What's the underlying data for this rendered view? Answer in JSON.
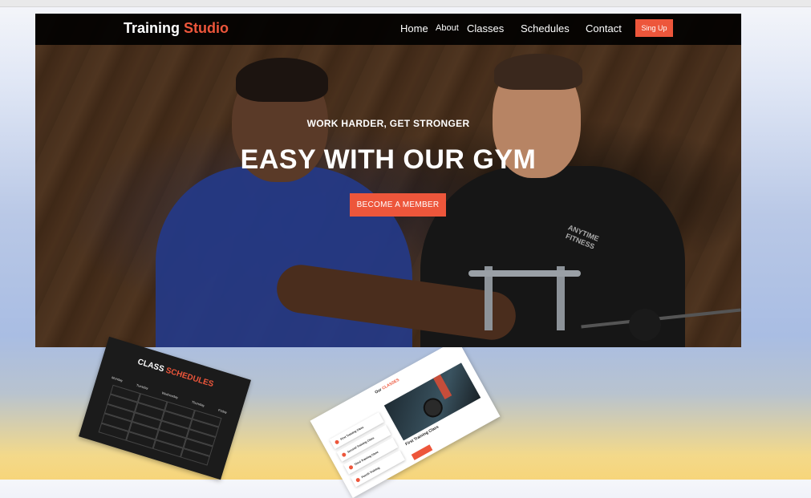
{
  "nav": {
    "logo_main": "Training",
    "logo_accent": "Studio",
    "items": [
      {
        "label": "Home"
      },
      {
        "label": "About"
      },
      {
        "label": "Classes"
      },
      {
        "label": "Schedules"
      },
      {
        "label": "Contact"
      }
    ],
    "signup_label": "Sing Up"
  },
  "hero": {
    "subtitle": "WORK HARDER, GET STRONGER",
    "title": "EASY WITH OUR GYM",
    "cta_label": "BECOME A MEMBER",
    "shirt_brand": "ANYTIME FITNESS"
  },
  "cards": {
    "schedules": {
      "title_main": "CLASS",
      "title_accent": "SCHEDULES",
      "tabs": [
        "Monday",
        "Tuesday",
        "Wednesday",
        "Thursday",
        "Friday"
      ]
    },
    "classes": {
      "title_main": "Our",
      "title_accent": "CLASSES",
      "items": [
        "First Training Class",
        "Second Training Class",
        "Third Training Class",
        "Fourth Training"
      ],
      "feature_title": "First Training Class"
    }
  },
  "colors": {
    "accent": "#ed563b",
    "nav_bg": "#000000"
  }
}
